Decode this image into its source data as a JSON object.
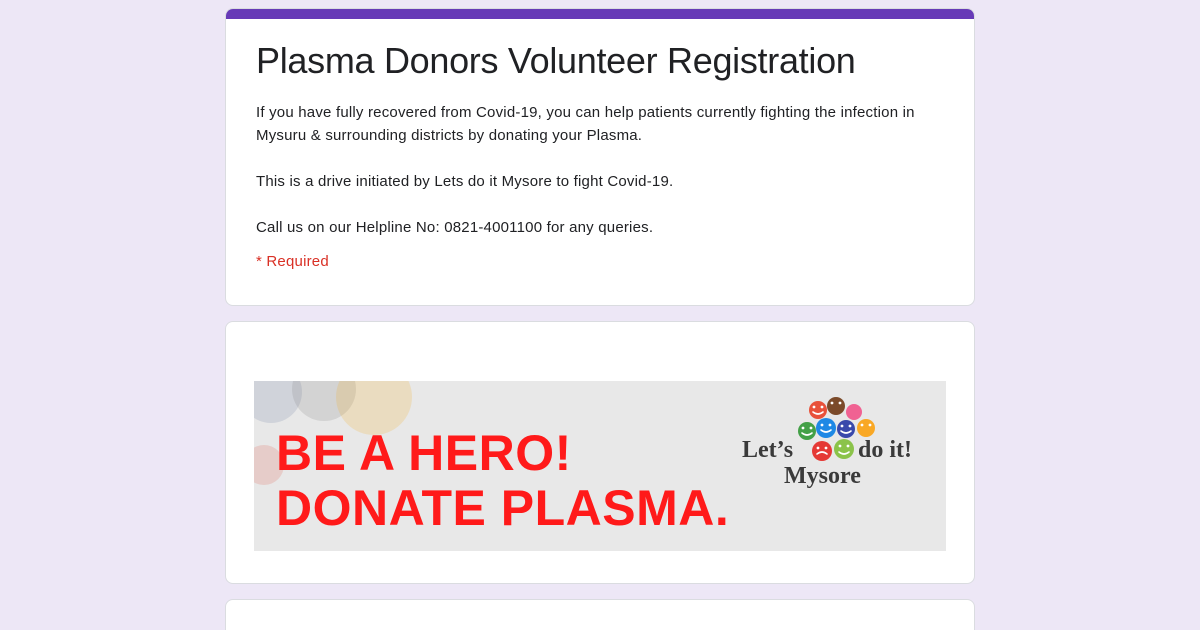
{
  "form": {
    "title": "Plasma Donors Volunteer Registration",
    "description": [
      "If you have fully recovered from Covid-19, you can help patients currently fighting the infection in Mysuru & surrounding districts by donating your Plasma.",
      "This is a drive initiated by Lets do it Mysore to fight Covid-19.",
      "Call us on our Helpline No: 0821-4001100 for any queries."
    ],
    "required_note": "* Required",
    "accent_color": "#673ab7",
    "background_color": "#ede7f6"
  },
  "banner": {
    "headline_line1": "BE A HERO!",
    "headline_line2": "DONATE PLASMA.",
    "headline_color": "#ff1a1a",
    "logo": {
      "text_left": "Let’s",
      "text_right": "do it!",
      "text_bottom": "Mysore",
      "face_colors": [
        "#e8513a",
        "#7b4a2a",
        "#1e88e5",
        "#3949ab",
        "#43a047",
        "#f9a825",
        "#e53935",
        "#8bc34a"
      ]
    }
  }
}
